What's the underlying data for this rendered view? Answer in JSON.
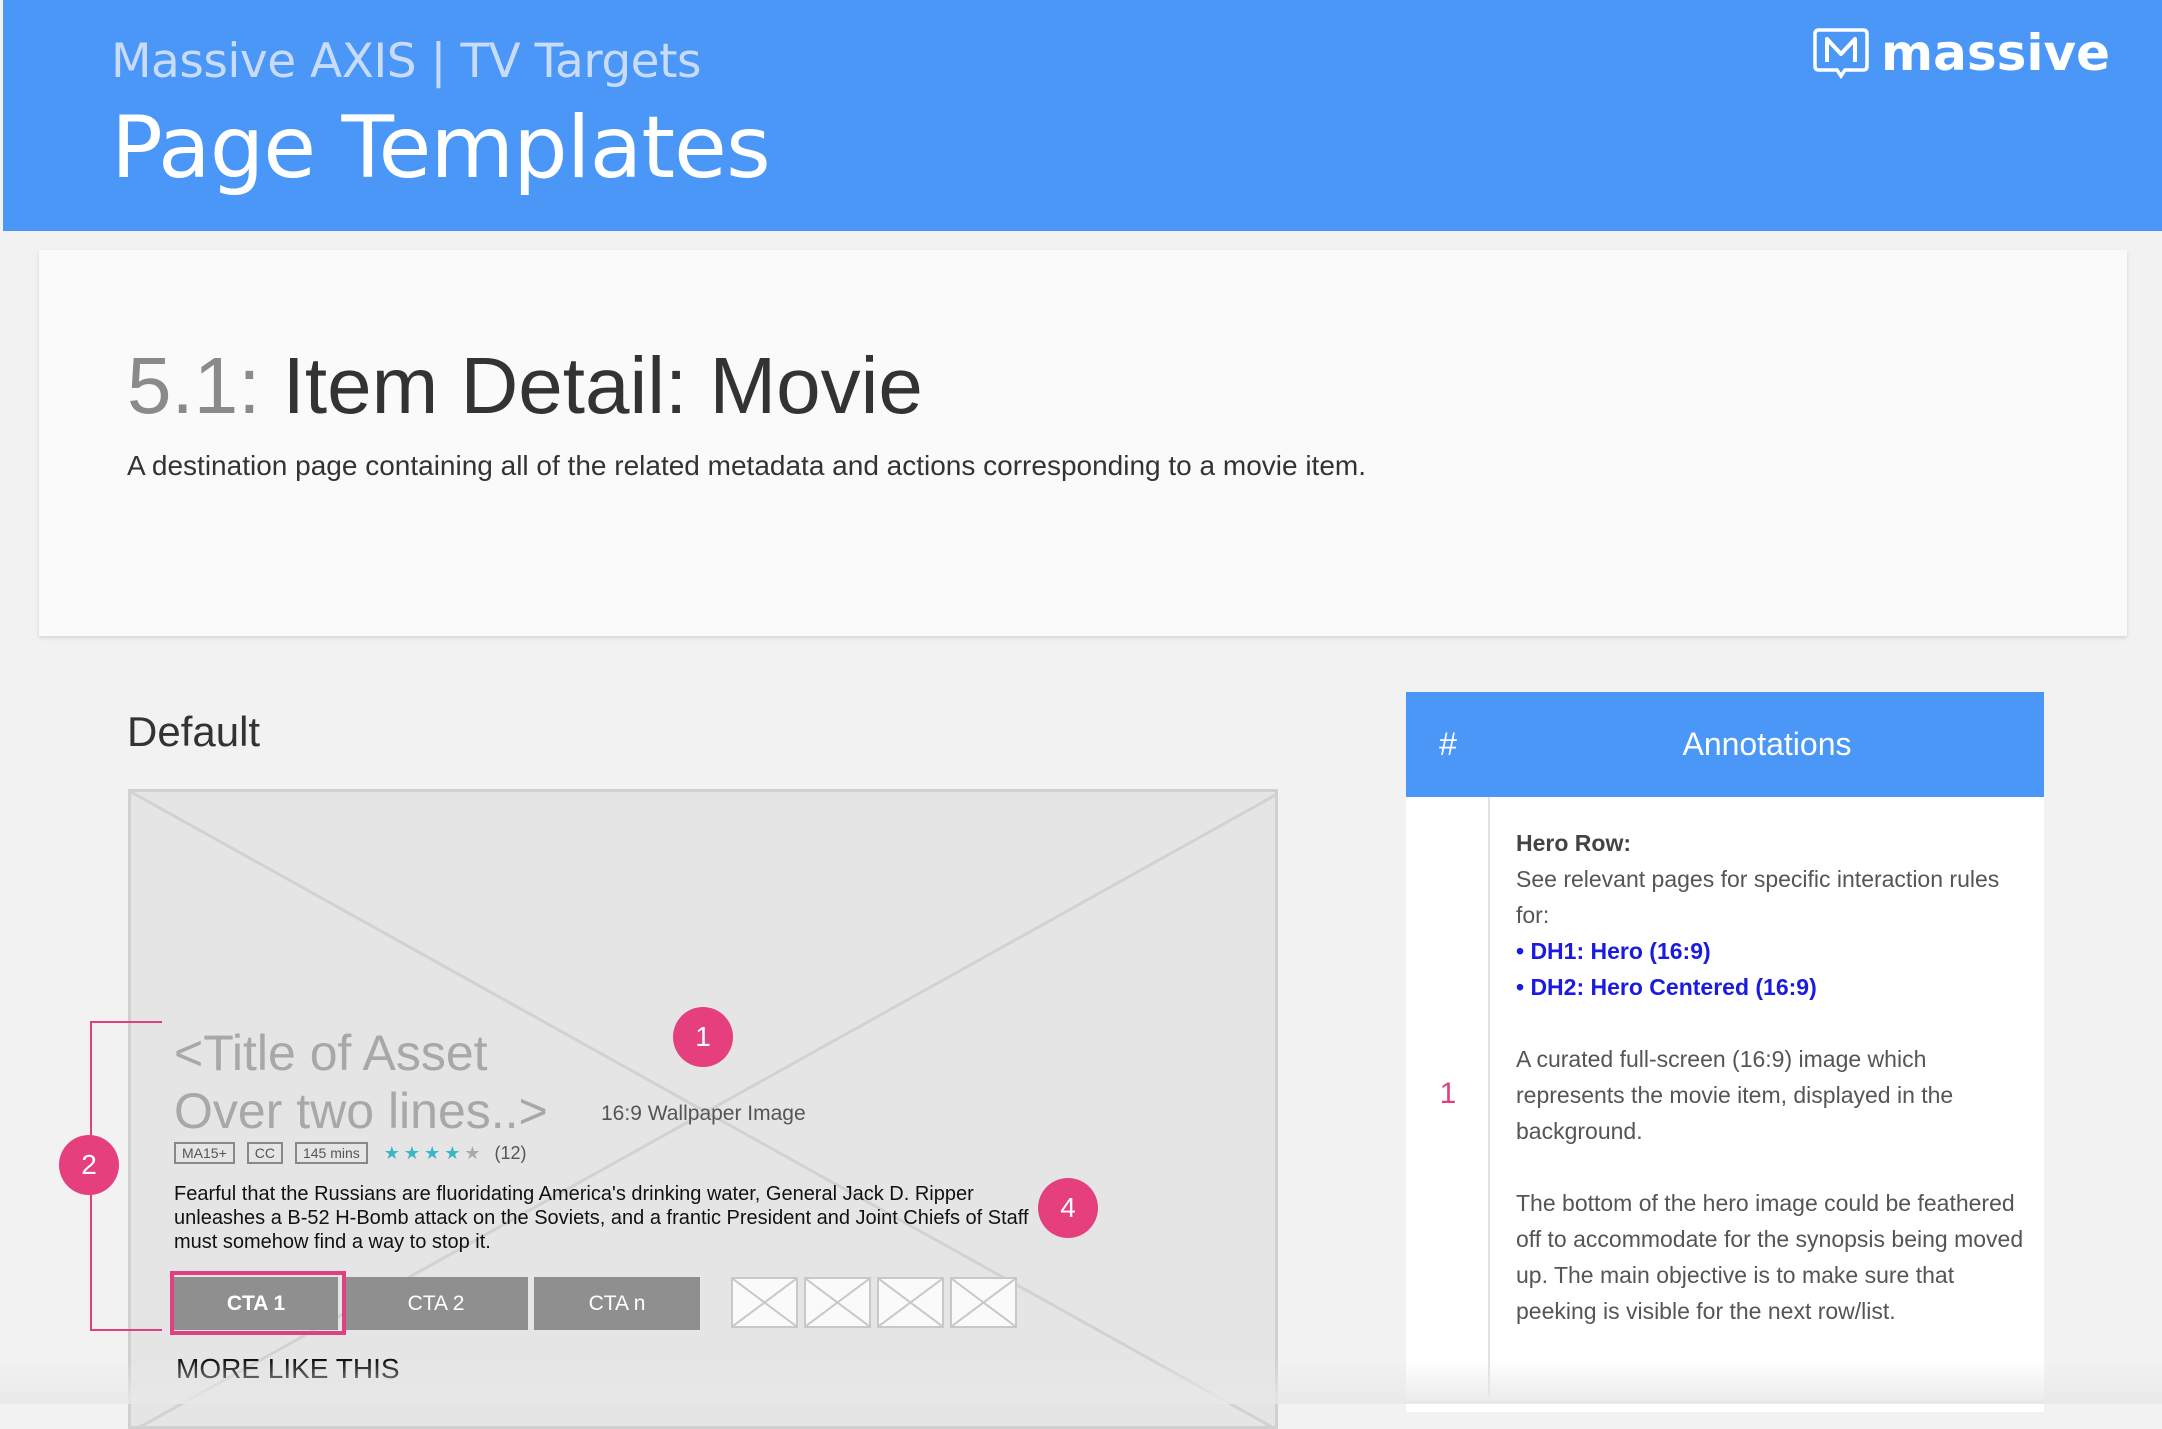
{
  "header": {
    "subtitle": "Massive AXIS | TV Targets",
    "title": "Page Templates",
    "logo_text": "massive",
    "background_color": "#4a97f7"
  },
  "section": {
    "number": "5.1:",
    "title": "Item Detail: Movie",
    "description": "A destination page containing all of the related metadata and actions corresponding to a movie item."
  },
  "variant_label": "Default",
  "wireframe": {
    "asset_title_line1": "<Title of Asset",
    "asset_title_line2": "Over two lines..>",
    "wallpaper_label": "16:9 Wallpaper Image",
    "badges": [
      "MA15+",
      "CC",
      "145 mins"
    ],
    "stars_filled": 4,
    "stars_total": 5,
    "rating_count": "(12)",
    "synopsis": "Fearful that the Russians are fluoridating America's drinking water, General Jack D. Ripper unleashes a B-52 H-Bomb attack on the Soviets, and a frantic President and Joint Chiefs of Staff must somehow find a way to stop it.",
    "ctas": [
      "CTA 1",
      "CTA 2",
      "CTA n"
    ],
    "more_like_this": "MORE LIKE THIS"
  },
  "markers": [
    "1",
    "2",
    "4"
  ],
  "annotations": {
    "hash_label": "#",
    "header_label": "Annotations",
    "rows": [
      {
        "number": "1",
        "heading": "Hero Row:",
        "intro": "See relevant pages for specific interaction rules for:",
        "links": [
          "• DH1: Hero (16:9)",
          "• DH2: Hero Centered (16:9)"
        ],
        "paragraph1": "A curated full-screen (16:9) image which represents the movie item, displayed in the background.",
        "paragraph2": "The bottom of the hero image could be feathered off to accommodate for the synopsis being moved up. The main objective is to make sure that peeking is visible for the next row/list."
      }
    ]
  },
  "colors": {
    "accent_blue": "#4a97f7",
    "marker_pink": "#e63f7e",
    "link_blue": "#1a1ae0"
  }
}
